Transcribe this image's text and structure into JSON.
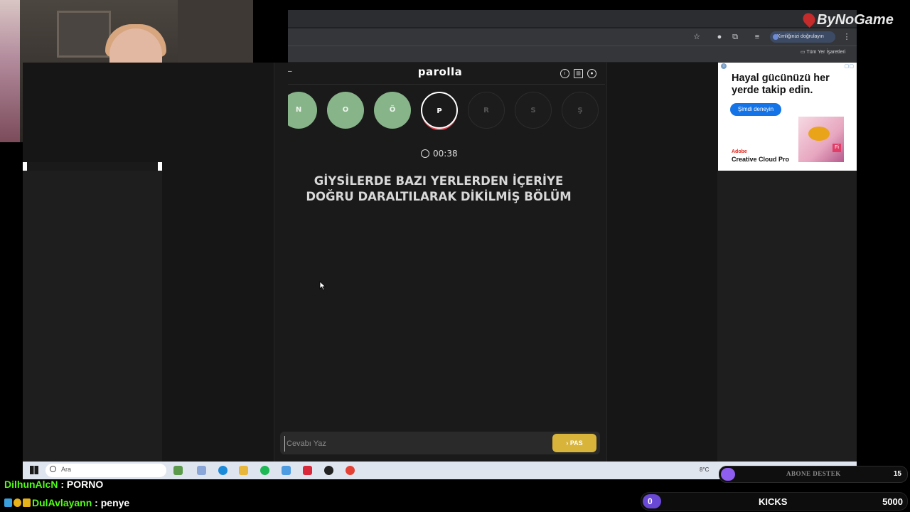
{
  "watermark": "ByNoGame",
  "browser": {
    "verify_label": "Kimliğinizi doğrulayın",
    "bookmarks_label": "Tüm Yer İşaretleri"
  },
  "game": {
    "title": "parolla",
    "letters": [
      {
        "char": "N",
        "state": "done"
      },
      {
        "char": "O",
        "state": "done"
      },
      {
        "char": "Ö",
        "state": "done"
      },
      {
        "char": "P",
        "state": "current"
      },
      {
        "char": "R",
        "state": "todo"
      },
      {
        "char": "S",
        "state": "todo"
      },
      {
        "char": "Ş",
        "state": "todo"
      }
    ],
    "timer": "00:38",
    "question": "GİYSİLERDE BAZI YERLERDEN İÇERİYE DOĞRU DARALTILARAK DİKİLMİŞ BÖLÜM",
    "answer_placeholder": "Cevabı Yaz",
    "pass_label": "PAS"
  },
  "ad": {
    "headline": "Hayal gücünüzü her yerde takip edin.",
    "cta": "Şimdi deneyin",
    "brand_line1": "Adobe",
    "brand_line2": "Creative Cloud Pro"
  },
  "taskbar": {
    "search_label": "Ara",
    "temperature": "8°C"
  },
  "stream": {
    "sub_goal_label": "ABONE DESTEK",
    "sub_goal_target": "15",
    "kicks_current": "0",
    "kicks_label": "KICKS",
    "kicks_goal": "5000",
    "chat": [
      {
        "user": "DilhunAlcN",
        "message": "PORNO"
      },
      {
        "user": "DulAvlayann",
        "message": "penye"
      }
    ]
  },
  "colors": {
    "letter_done": "#87b489",
    "current_ring": "#e34b55",
    "pass_button": "#d8b53a",
    "chat_username": "#53fc18",
    "kicks_fill": "#6a48d6",
    "ad_cta": "#1473e6"
  }
}
